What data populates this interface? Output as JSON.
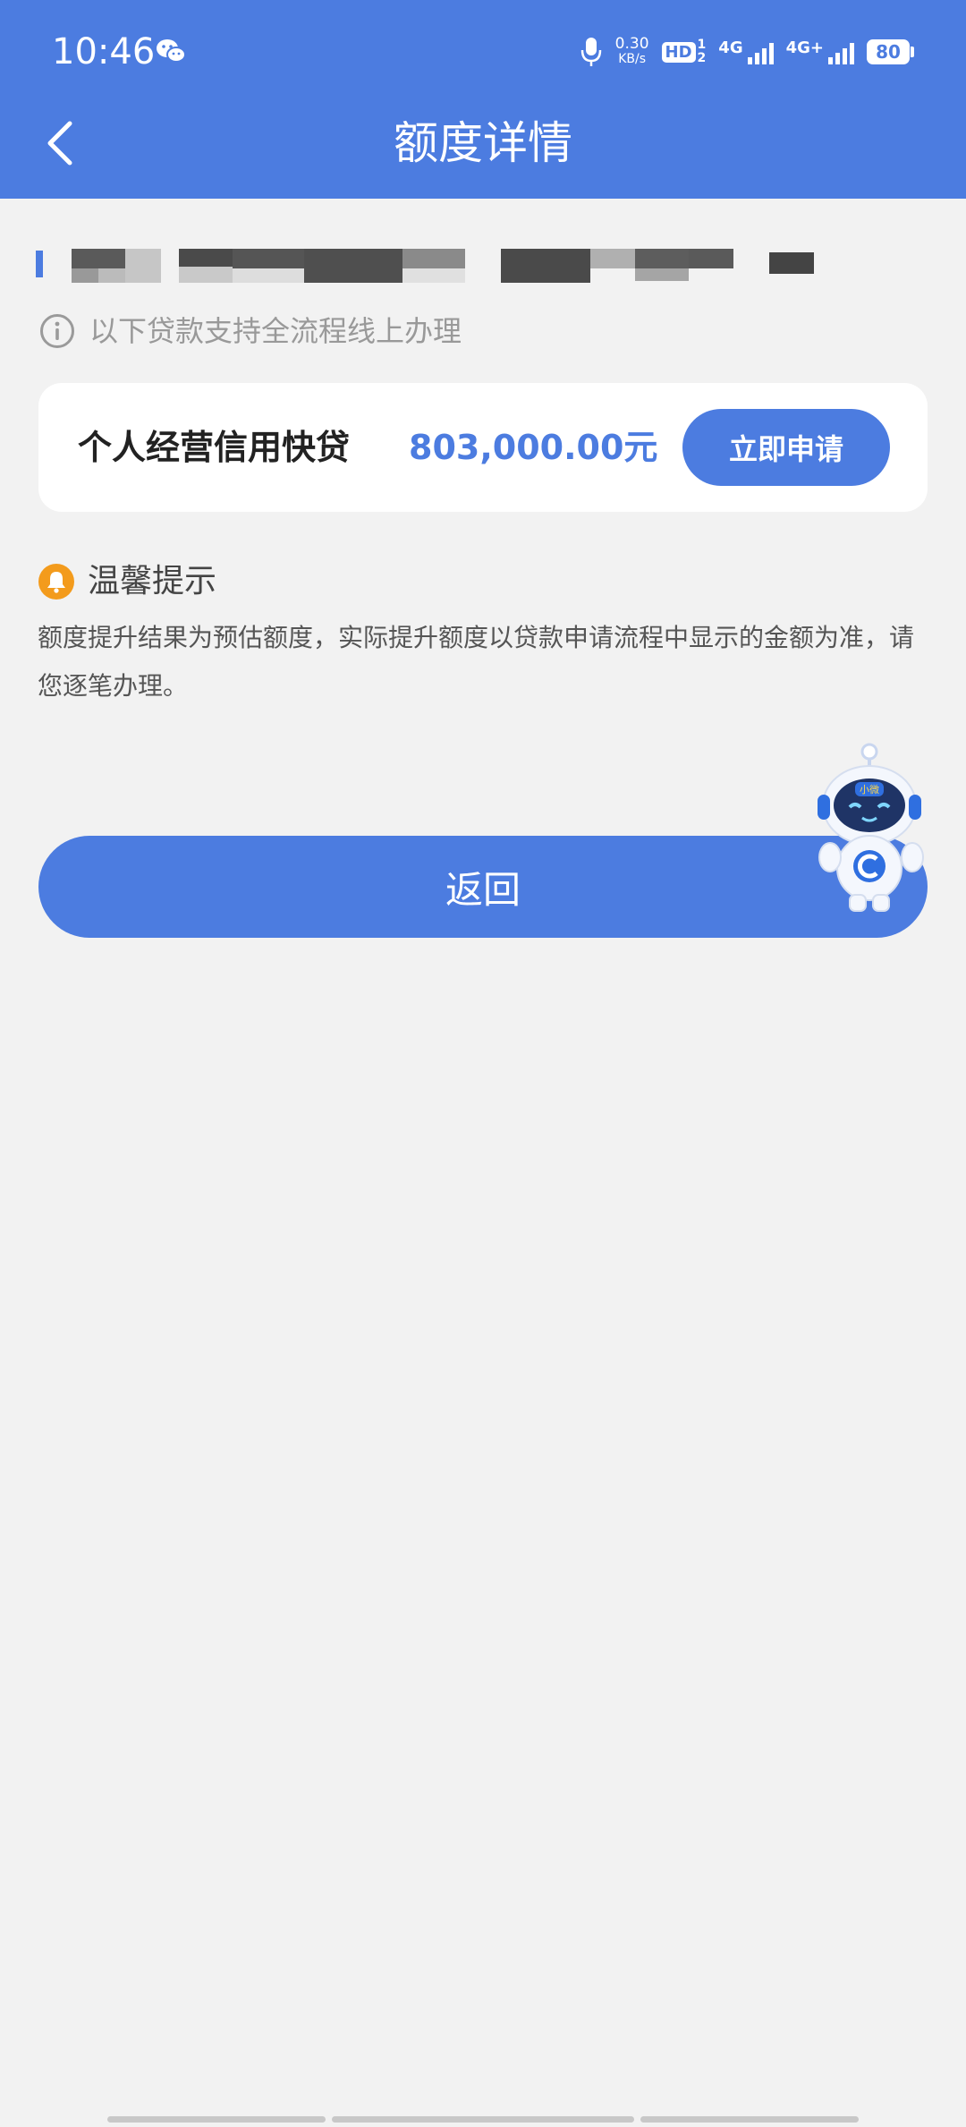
{
  "status_bar": {
    "time": "10:46",
    "net_speed_value": "0.30",
    "net_speed_unit": "KB/s",
    "hd_label": "HD",
    "hd_sim1": "1",
    "hd_sim2": "2",
    "network_1": "4G",
    "network_2": "4G+",
    "battery": "80"
  },
  "header": {
    "title": "额度详情"
  },
  "tip": {
    "text": "以下贷款支持全流程线上办理"
  },
  "loan_card": {
    "name": "个人经营信用快贷",
    "amount": "803,000.00元",
    "apply_label": "立即申请"
  },
  "notice": {
    "title": "温馨提示",
    "body": "额度提升结果为预估额度，实际提升额度以贷款申请流程中显示的金额为准，请您逐笔办理。"
  },
  "actions": {
    "return_label": "返回"
  },
  "mascot": {
    "badge_text": "小微"
  },
  "colors": {
    "primary": "#4c7ce0",
    "background": "#f2f2f2",
    "bell": "#f39b1c"
  }
}
